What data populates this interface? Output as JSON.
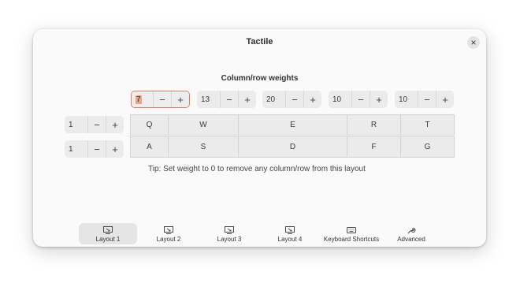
{
  "window": {
    "title": "Tactile"
  },
  "section_title": "Column/row weights",
  "column_weights": [
    {
      "value": "7",
      "focused": true
    },
    {
      "value": "13"
    },
    {
      "value": "20"
    },
    {
      "value": "10"
    },
    {
      "value": "10"
    }
  ],
  "row_weights": [
    {
      "value": "1"
    },
    {
      "value": "1"
    }
  ],
  "stepper": {
    "minus": "−",
    "plus": "+"
  },
  "keys": {
    "row1": [
      "Q",
      "W",
      "E",
      "R",
      "T"
    ],
    "row2": [
      "A",
      "S",
      "D",
      "F",
      "G"
    ]
  },
  "tip": "Tip: Set weight to 0 to remove any column/row from this layout",
  "tabs": [
    {
      "label": "Layout 1",
      "icon": "layout-icon",
      "active": true
    },
    {
      "label": "Layout 2",
      "icon": "layout-icon"
    },
    {
      "label": "Layout 3",
      "icon": "layout-icon"
    },
    {
      "label": "Layout 4",
      "icon": "layout-icon"
    },
    {
      "label": "Keyboard Shortcuts",
      "icon": "keyboard-icon"
    },
    {
      "label": "Advanced",
      "icon": "wrench-icon"
    }
  ],
  "colors": {
    "focus_border": "#e67e5e",
    "selection": "#e7a48a"
  }
}
